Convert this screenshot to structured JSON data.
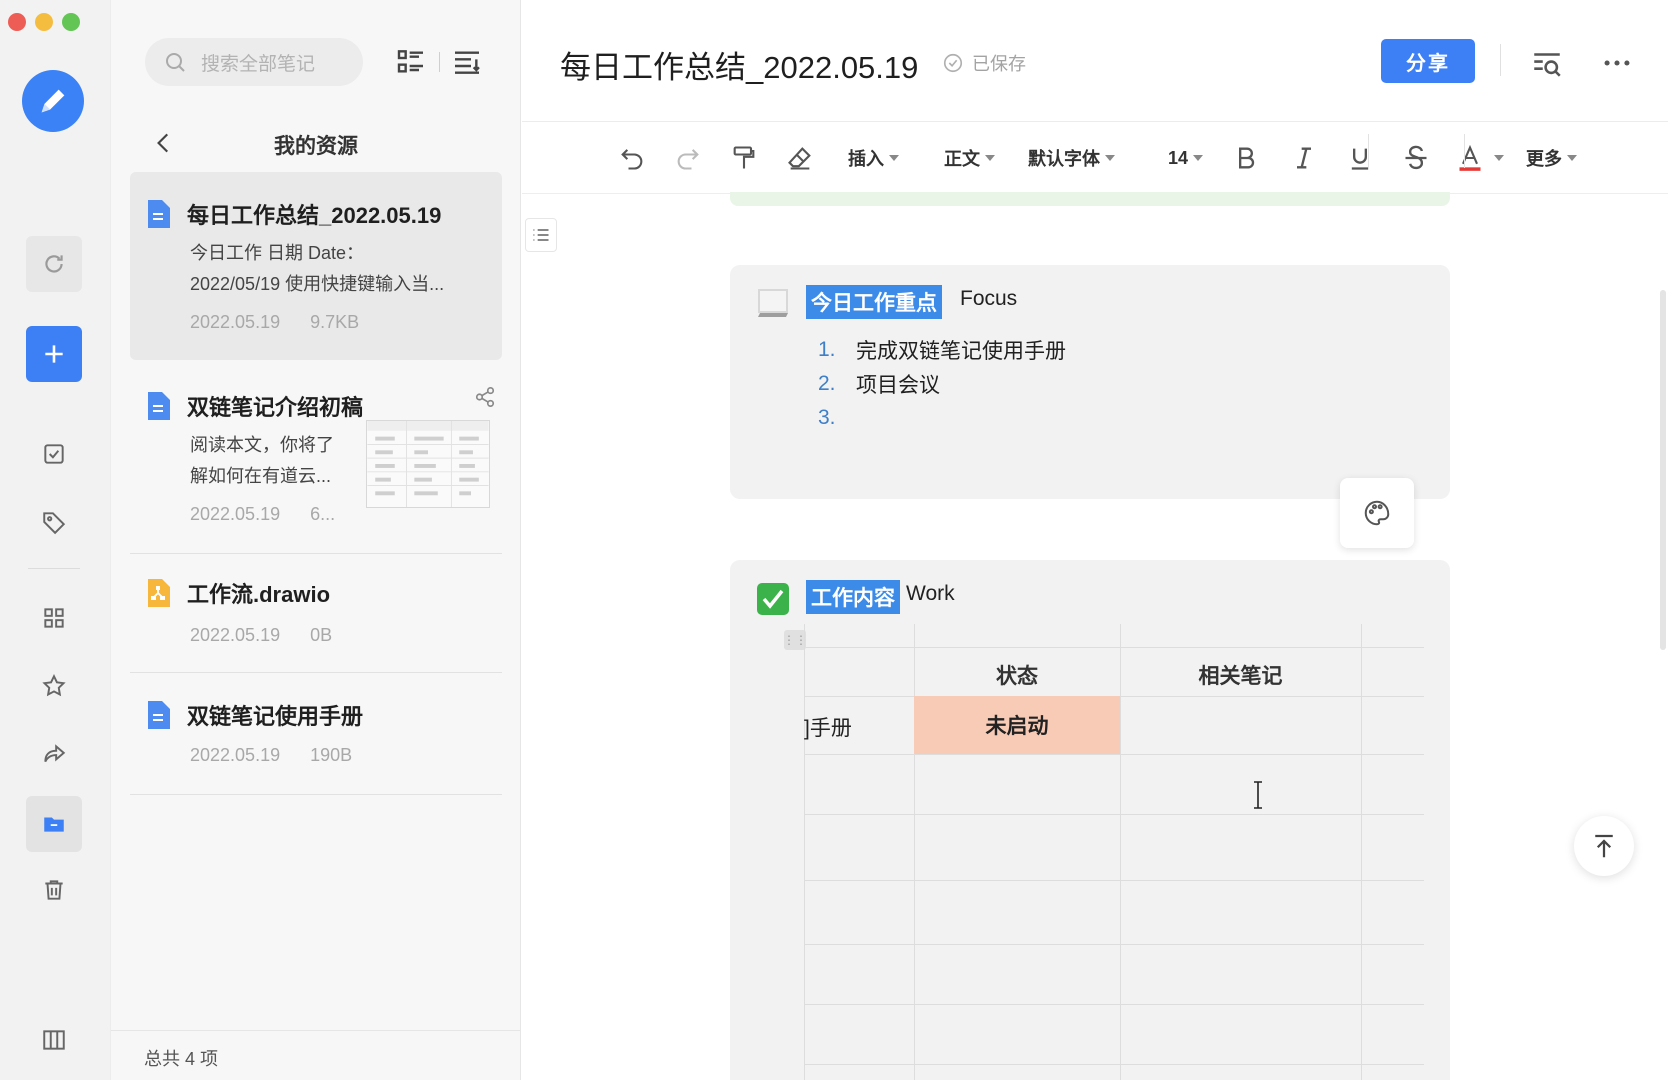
{
  "search": {
    "placeholder": "搜索全部笔记"
  },
  "list": {
    "title": "我的资源",
    "items": [
      {
        "title": "每日工作总结_2022.05.19",
        "snippet1": "今日工作 日期 Date：",
        "snippet2": "2022/05/19 使用快捷键输入当...",
        "date": "2022.05.19",
        "size": "9.7KB",
        "icon": "doc-icon"
      },
      {
        "title": "双链笔记介绍初稿",
        "snippet1": "阅读本文，你将了",
        "snippet2": "解如何在有道云...",
        "date": "2022.05.19",
        "size": "6...",
        "icon": "doc-icon"
      },
      {
        "title": "工作流.drawio",
        "date": "2022.05.19",
        "size": "0B",
        "icon": "drawio-icon"
      },
      {
        "title": "双链笔记使用手册",
        "date": "2022.05.19",
        "size": "190B",
        "icon": "doc-icon"
      }
    ],
    "footer": "总共 4 项"
  },
  "editor": {
    "title": "每日工作总结_2022.05.19",
    "saved": "已保存",
    "share": "分享"
  },
  "toolbar": {
    "insert": "插入",
    "style": "正文",
    "font": "默认字体",
    "size": "14",
    "more": "更多"
  },
  "focus_block": {
    "tag": "今日工作重点",
    "en": "Focus",
    "items": [
      {
        "num": "1.",
        "text": "完成双链笔记使用手册"
      },
      {
        "num": "2.",
        "text": "项目会议"
      },
      {
        "num": "3.",
        "text": ""
      }
    ]
  },
  "work_block": {
    "tag": "工作内容",
    "en": "Work",
    "headers": [
      "状态",
      "相关笔记"
    ],
    "row1_task": "]手册",
    "row1_status": "未启动"
  },
  "colors": {
    "accent": "#3d7ff5",
    "status_not_started": "#f8cbb7"
  }
}
